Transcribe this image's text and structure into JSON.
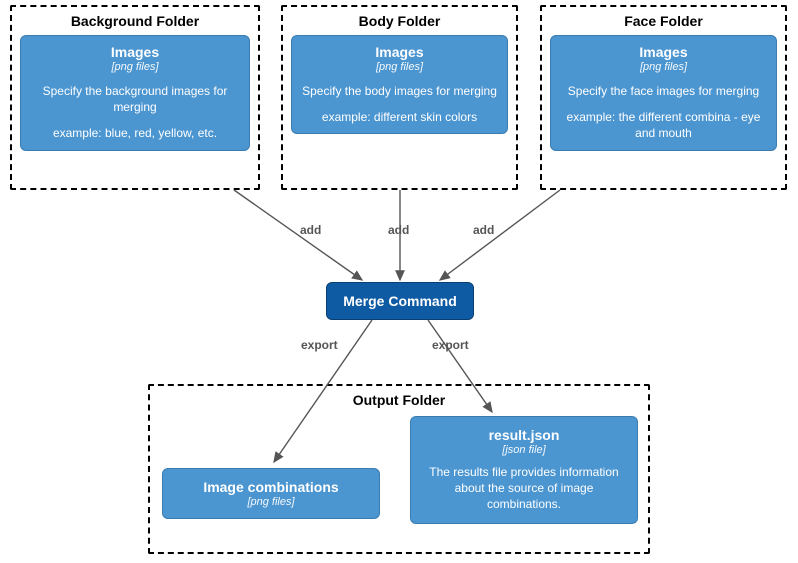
{
  "folders": {
    "background": {
      "title": "Background Folder",
      "card": {
        "title": "Images",
        "subtitle": "[png files]",
        "desc": "Specify the background images for merging",
        "example": "example: blue, red, yellow, etc."
      }
    },
    "body": {
      "title": "Body Folder",
      "card": {
        "title": "Images",
        "subtitle": "[png files]",
        "desc": "Specify the body images for merging",
        "example": "example: different skin colors"
      }
    },
    "face": {
      "title": "Face Folder",
      "card": {
        "title": "Images",
        "subtitle": "[png files]",
        "desc": "Specify the face images for merging",
        "example": "example: the different combina - eye and mouth"
      }
    }
  },
  "merge": {
    "label": "Merge Command"
  },
  "output": {
    "title": "Output Folder",
    "combinations": {
      "title": "Image combinations",
      "subtitle": "[png files]"
    },
    "result": {
      "title": "result.json",
      "subtitle": "[json file]",
      "desc": "The results file provides information about the source of image combinations."
    }
  },
  "edges": {
    "add1": "add",
    "add2": "add",
    "add3": "add",
    "export1": "export",
    "export2": "export"
  }
}
